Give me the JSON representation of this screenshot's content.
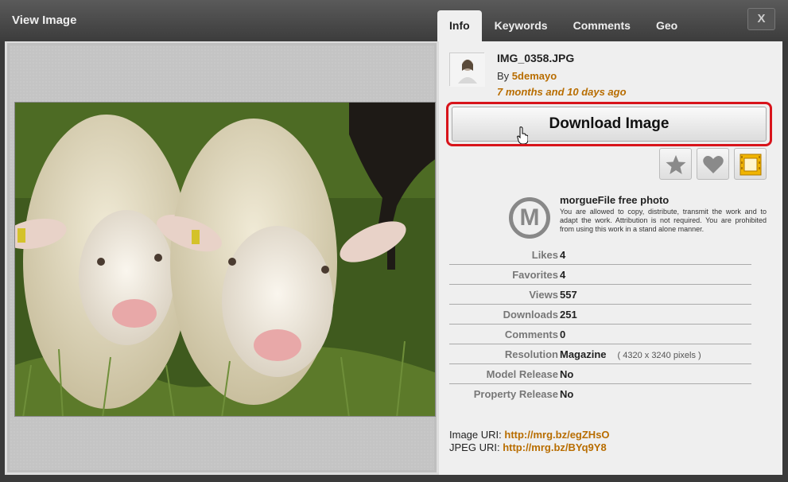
{
  "window": {
    "title": "View Image",
    "close_label": "X"
  },
  "tabs": [
    {
      "label": "Info",
      "active": true
    },
    {
      "label": "Keywords",
      "active": false
    },
    {
      "label": "Comments",
      "active": false
    },
    {
      "label": "Geo",
      "active": false
    }
  ],
  "image": {
    "alt": "two white sheep in grass"
  },
  "info": {
    "filename": "IMG_0358.JPG",
    "by_prefix": "By",
    "author": "5demayo",
    "age": "7 months and 10 days ago",
    "download_label": "Download Image",
    "actions": [
      {
        "name": "favorite-star-icon"
      },
      {
        "name": "like-heart-icon"
      },
      {
        "name": "lightbox-icon"
      }
    ],
    "license": {
      "logo_letter": "M",
      "title": "morgueFile free photo",
      "text": "You are allowed to copy, distribute, transmit the work and to adapt the work. Attribution is not required. You are prohibited from using this work in a stand alone manner."
    },
    "stats": [
      {
        "key": "Likes",
        "value": "4",
        "note": ""
      },
      {
        "key": "Favorites",
        "value": "4",
        "note": ""
      },
      {
        "key": "Views",
        "value": "557",
        "note": ""
      },
      {
        "key": "Downloads",
        "value": "251",
        "note": ""
      },
      {
        "key": "Comments",
        "value": "0",
        "note": ""
      },
      {
        "key": "Resolution",
        "value": "Magazine",
        "note": "( 4320 x 3240 pixels )"
      },
      {
        "key": "Model Release",
        "value": "No",
        "note": ""
      },
      {
        "key": "Property Release",
        "value": "No",
        "note": ""
      }
    ],
    "image_uri_label": "Image URI:",
    "image_uri": "http://mrg.bz/egZHsO",
    "jpeg_uri_label": "JPEG URI:",
    "jpeg_uri": "http://mrg.bz/BYq9Y8"
  },
  "colors": {
    "accent": "#b86d00",
    "highlight": "#d8141b"
  }
}
